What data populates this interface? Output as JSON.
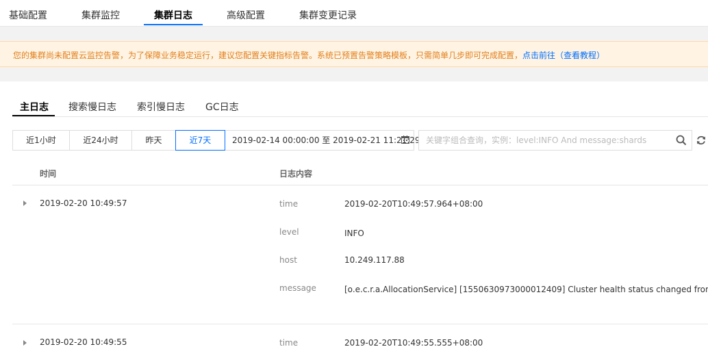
{
  "top_tabs": [
    {
      "label": "基础配置"
    },
    {
      "label": "集群监控"
    },
    {
      "label": "集群日志",
      "active": true
    },
    {
      "label": "高级配置"
    },
    {
      "label": "集群变更记录"
    }
  ],
  "alert": {
    "message": "您的集群尚未配置云监控告警，为了保障业务稳定运行，建议您配置关键指标告警。系统已预置告警策略模板，只需简单几步即可完成配置，",
    "link_go": "点击前往",
    "paren_open": "（",
    "link_tutorial": "查看教程",
    "paren_close": "）"
  },
  "log_tabs": [
    {
      "label": "主日志",
      "active": true
    },
    {
      "label": "搜索慢日志"
    },
    {
      "label": "索引慢日志"
    },
    {
      "label": "GC日志"
    }
  ],
  "time_buttons": [
    {
      "label": "近1小时"
    },
    {
      "label": "近24小时"
    },
    {
      "label": "昨天"
    },
    {
      "label": "近7天",
      "active": true
    }
  ],
  "date_range": {
    "start": "2019-02-14 00:00:00",
    "separator": "至",
    "end": "2019-02-21 11:21:29"
  },
  "search": {
    "placeholder": "关键字组合查询，实例：level:INFO And message:shards",
    "value": ""
  },
  "table": {
    "col_time": "时间",
    "col_content": "日志内容",
    "rows": [
      {
        "time": "2019-02-20 10:49:57",
        "fields": [
          {
            "key": "time",
            "value": "2019-02-20T10:49:57.964+08:00"
          },
          {
            "key": "level",
            "value": "INFO"
          },
          {
            "key": "host",
            "value": "10.249.117.88"
          },
          {
            "key": "message",
            "value": "[o.e.c.r.a.AllocationService] [1550630973000012409] Cluster health status changed from [YELLOW] to [GREEN] (reason: [shards started [[sales][0]] ...])."
          }
        ]
      },
      {
        "time": "2019-02-20 10:49:55",
        "fields": [
          {
            "key": "time",
            "value": "2019-02-20T10:49:55.555+08:00"
          }
        ]
      }
    ]
  },
  "colors": {
    "accent": "#006eff",
    "alert_text": "#e07f1d",
    "alert_bg": "#fff4e3"
  },
  "icons": {
    "calendar": "calendar-icon",
    "search": "search-icon",
    "refresh": "refresh-icon",
    "expand": "caret-right-icon"
  }
}
